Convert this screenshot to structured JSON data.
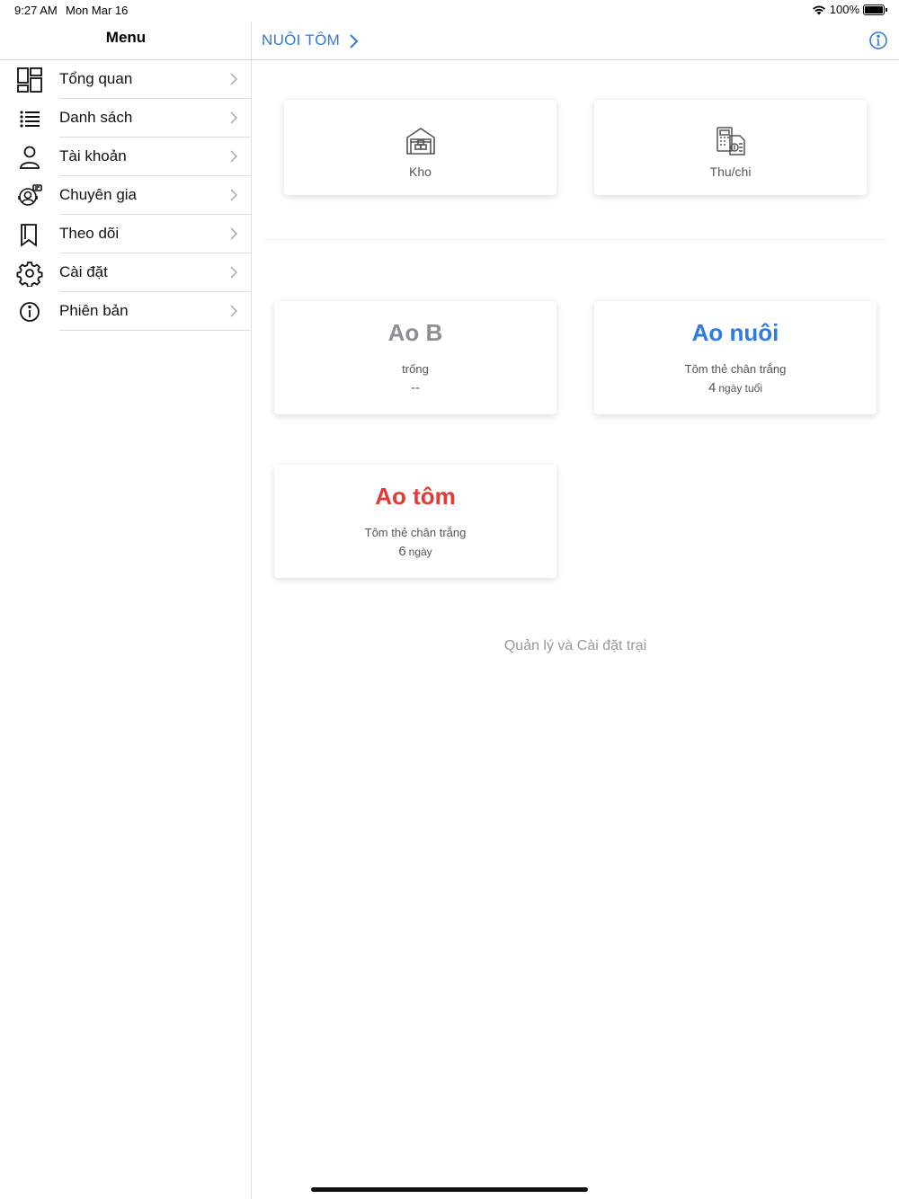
{
  "status": {
    "time": "9:27 AM",
    "date": "Mon Mar 16",
    "battery": "100%"
  },
  "sidebar": {
    "title": "Menu",
    "items": [
      {
        "label": "Tổng quan",
        "icon": "dashboard-icon"
      },
      {
        "label": "Danh sách",
        "icon": "list-icon"
      },
      {
        "label": "Tài khoản",
        "icon": "user-icon"
      },
      {
        "label": "Chuyên gia",
        "icon": "expert-support-icon"
      },
      {
        "label": "Theo dõi",
        "icon": "bookmark-icon"
      },
      {
        "label": "Cài đặt",
        "icon": "gear-icon"
      },
      {
        "label": "Phiên bản",
        "icon": "info-icon"
      }
    ]
  },
  "nav": {
    "title": "NUÔI TÔM"
  },
  "tools": [
    {
      "label": "Kho",
      "icon": "warehouse-icon"
    },
    {
      "label": "Thu/chi",
      "icon": "finance-icon"
    }
  ],
  "ponds": [
    {
      "name": "Ao B",
      "subtitle": "trống",
      "age_value": "--",
      "age_unit": "",
      "color": "#8e8e93"
    },
    {
      "name": "Ao nuôi",
      "subtitle": "Tôm thẻ chân trắng",
      "age_value": "4",
      "age_unit": "ngày tuổi",
      "color": "#2f7ae5"
    },
    {
      "name": "Ao tôm",
      "subtitle": "Tôm thẻ chân trắng",
      "age_value": "6",
      "age_unit": "ngày",
      "color": "#e53935"
    }
  ],
  "footer": {
    "text": "Quản lý và Cài đặt trại"
  },
  "colors": {
    "accent": "#2f7ae5"
  }
}
